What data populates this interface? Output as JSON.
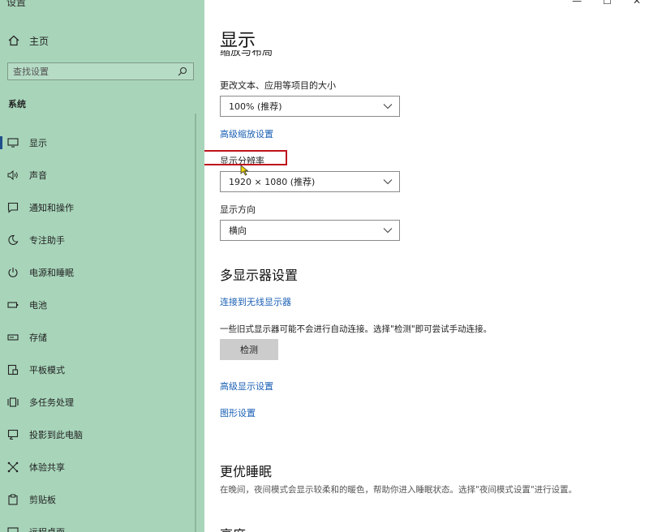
{
  "window": {
    "title": "设置",
    "controls": [
      "—",
      "☐",
      "✕"
    ]
  },
  "sidebar": {
    "home_label": "主页",
    "search_placeholder": "查找设置",
    "section_title": "系统",
    "items": [
      {
        "label": "显示",
        "icon": "monitor-icon",
        "active": true
      },
      {
        "label": "声音",
        "icon": "speaker-icon"
      },
      {
        "label": "通知和操作",
        "icon": "notification-icon"
      },
      {
        "label": "专注助手",
        "icon": "moon-icon"
      },
      {
        "label": "电源和睡眠",
        "icon": "power-icon"
      },
      {
        "label": "电池",
        "icon": "battery-icon"
      },
      {
        "label": "存储",
        "icon": "storage-icon"
      },
      {
        "label": "平板模式",
        "icon": "tablet-icon"
      },
      {
        "label": "多任务处理",
        "icon": "multitask-icon"
      },
      {
        "label": "投影到此电脑",
        "icon": "project-icon"
      },
      {
        "label": "体验共享",
        "icon": "share-icon"
      },
      {
        "label": "剪贴板",
        "icon": "clipboard-icon"
      },
      {
        "label": "远程桌面",
        "icon": "remote-icon"
      }
    ]
  },
  "main": {
    "title": "显示",
    "cut_heading": "缩放与布局",
    "scale": {
      "label": "更改文本、应用等项目的大小",
      "value": "100% (推荐)",
      "advanced_link": "高级缩放设置"
    },
    "resolution": {
      "label": "显示分辨率",
      "value": "1920 × 1080 (推荐)"
    },
    "orientation": {
      "label": "显示方向",
      "value": "横向"
    },
    "multi_display": {
      "heading": "多显示器设置",
      "wireless_link": "连接到无线显示器",
      "note": "一些旧式显示器可能不会进行自动连接。选择\"检测\"即可尝试手动连接。",
      "detect_button": "检测",
      "advanced_link": "高级显示设置",
      "graphics_link": "图形设置"
    },
    "sleep": {
      "heading": "更优睡眠",
      "desc": "在晚间，夜间模式会显示较柔和的暖色，帮助你进入睡眠状态。选择\"夜间模式设置\"进行设置。"
    },
    "cut_bottom_heading": "亮度"
  },
  "colors": {
    "sidebar_bg": "#a8d5ba",
    "link": "#1a5fb4",
    "highlight": "#c0141c"
  }
}
